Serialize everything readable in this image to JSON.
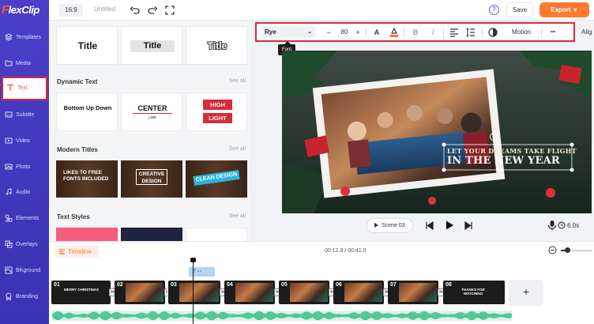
{
  "app": {
    "logo": "lexClip",
    "logo_mark": "F"
  },
  "sidebar": {
    "items": [
      {
        "label": "Templates",
        "icon": "layers-icon"
      },
      {
        "label": "Media",
        "icon": "folder-icon"
      },
      {
        "label": "Text",
        "icon": "text-icon",
        "active": true
      },
      {
        "label": "Subtitle",
        "icon": "subtitle-icon"
      },
      {
        "label": "Video",
        "icon": "video-icon"
      },
      {
        "label": "Photo",
        "icon": "photo-icon"
      },
      {
        "label": "Audio",
        "icon": "audio-icon"
      },
      {
        "label": "Elements",
        "icon": "elements-icon"
      },
      {
        "label": "Overlays",
        "icon": "overlays-icon"
      },
      {
        "label": "BKground",
        "icon": "background-icon"
      },
      {
        "label": "Branding",
        "icon": "branding-icon"
      }
    ]
  },
  "topbar": {
    "ratio": "16:9",
    "title": "Untitled",
    "help": "?",
    "save": "Save",
    "export": "Export"
  },
  "panel": {
    "title_cards": [
      "Title",
      "Title",
      "Title"
    ],
    "dynamic": {
      "heading": "Dynamic Text",
      "see_all": "See all",
      "cards": {
        "bounce": "Bottom Up Down",
        "center": "CENTER",
        "center_sub": "LINE",
        "high": "HIGH",
        "light": "LIGHT"
      }
    },
    "modern": {
      "heading": "Modern Titles",
      "see_all": "See all",
      "cards": {
        "free": "LIKES TO FREE FONTS INCLUDED",
        "creative1": "CREATIVE",
        "creative2": "DESIGN",
        "clean": "CLEAN DESIGN"
      }
    },
    "styles": {
      "heading": "Text Styles",
      "see_all": "See all"
    }
  },
  "editor_toolbar": {
    "font": "Rye",
    "size": "80",
    "minus": "−",
    "plus": "+",
    "text_color": "A",
    "bold": "B",
    "italic": "I",
    "motion": "Motion",
    "more": "•••",
    "tooltip": "Font",
    "align_more": "Alig"
  },
  "preview": {
    "line1": "LET YOUR DREAMS TAKE FLIGHT",
    "line2": "IN THE NEW YEAR"
  },
  "playback": {
    "scene": "Scene 03",
    "duration": "6.0s"
  },
  "timeline": {
    "label": "Timeline",
    "time": "00:12.9 / 00:41.0",
    "clips": [
      {
        "num": "01",
        "text": "MERRY CHRISTMAS"
      },
      {
        "num": "02",
        "text": ""
      },
      {
        "num": "03",
        "text": ""
      },
      {
        "num": "04",
        "text": ""
      },
      {
        "num": "05",
        "text": ""
      },
      {
        "num": "06",
        "text": ""
      },
      {
        "num": "07",
        "text": ""
      },
      {
        "num": "08",
        "text": "THANKS FOR WATCHING"
      }
    ],
    "text_track_label": "T",
    "add": "+"
  },
  "colors": {
    "brand": "#4b3fc7",
    "accent": "#ff7a2e",
    "highlight": "#d62b3a"
  }
}
